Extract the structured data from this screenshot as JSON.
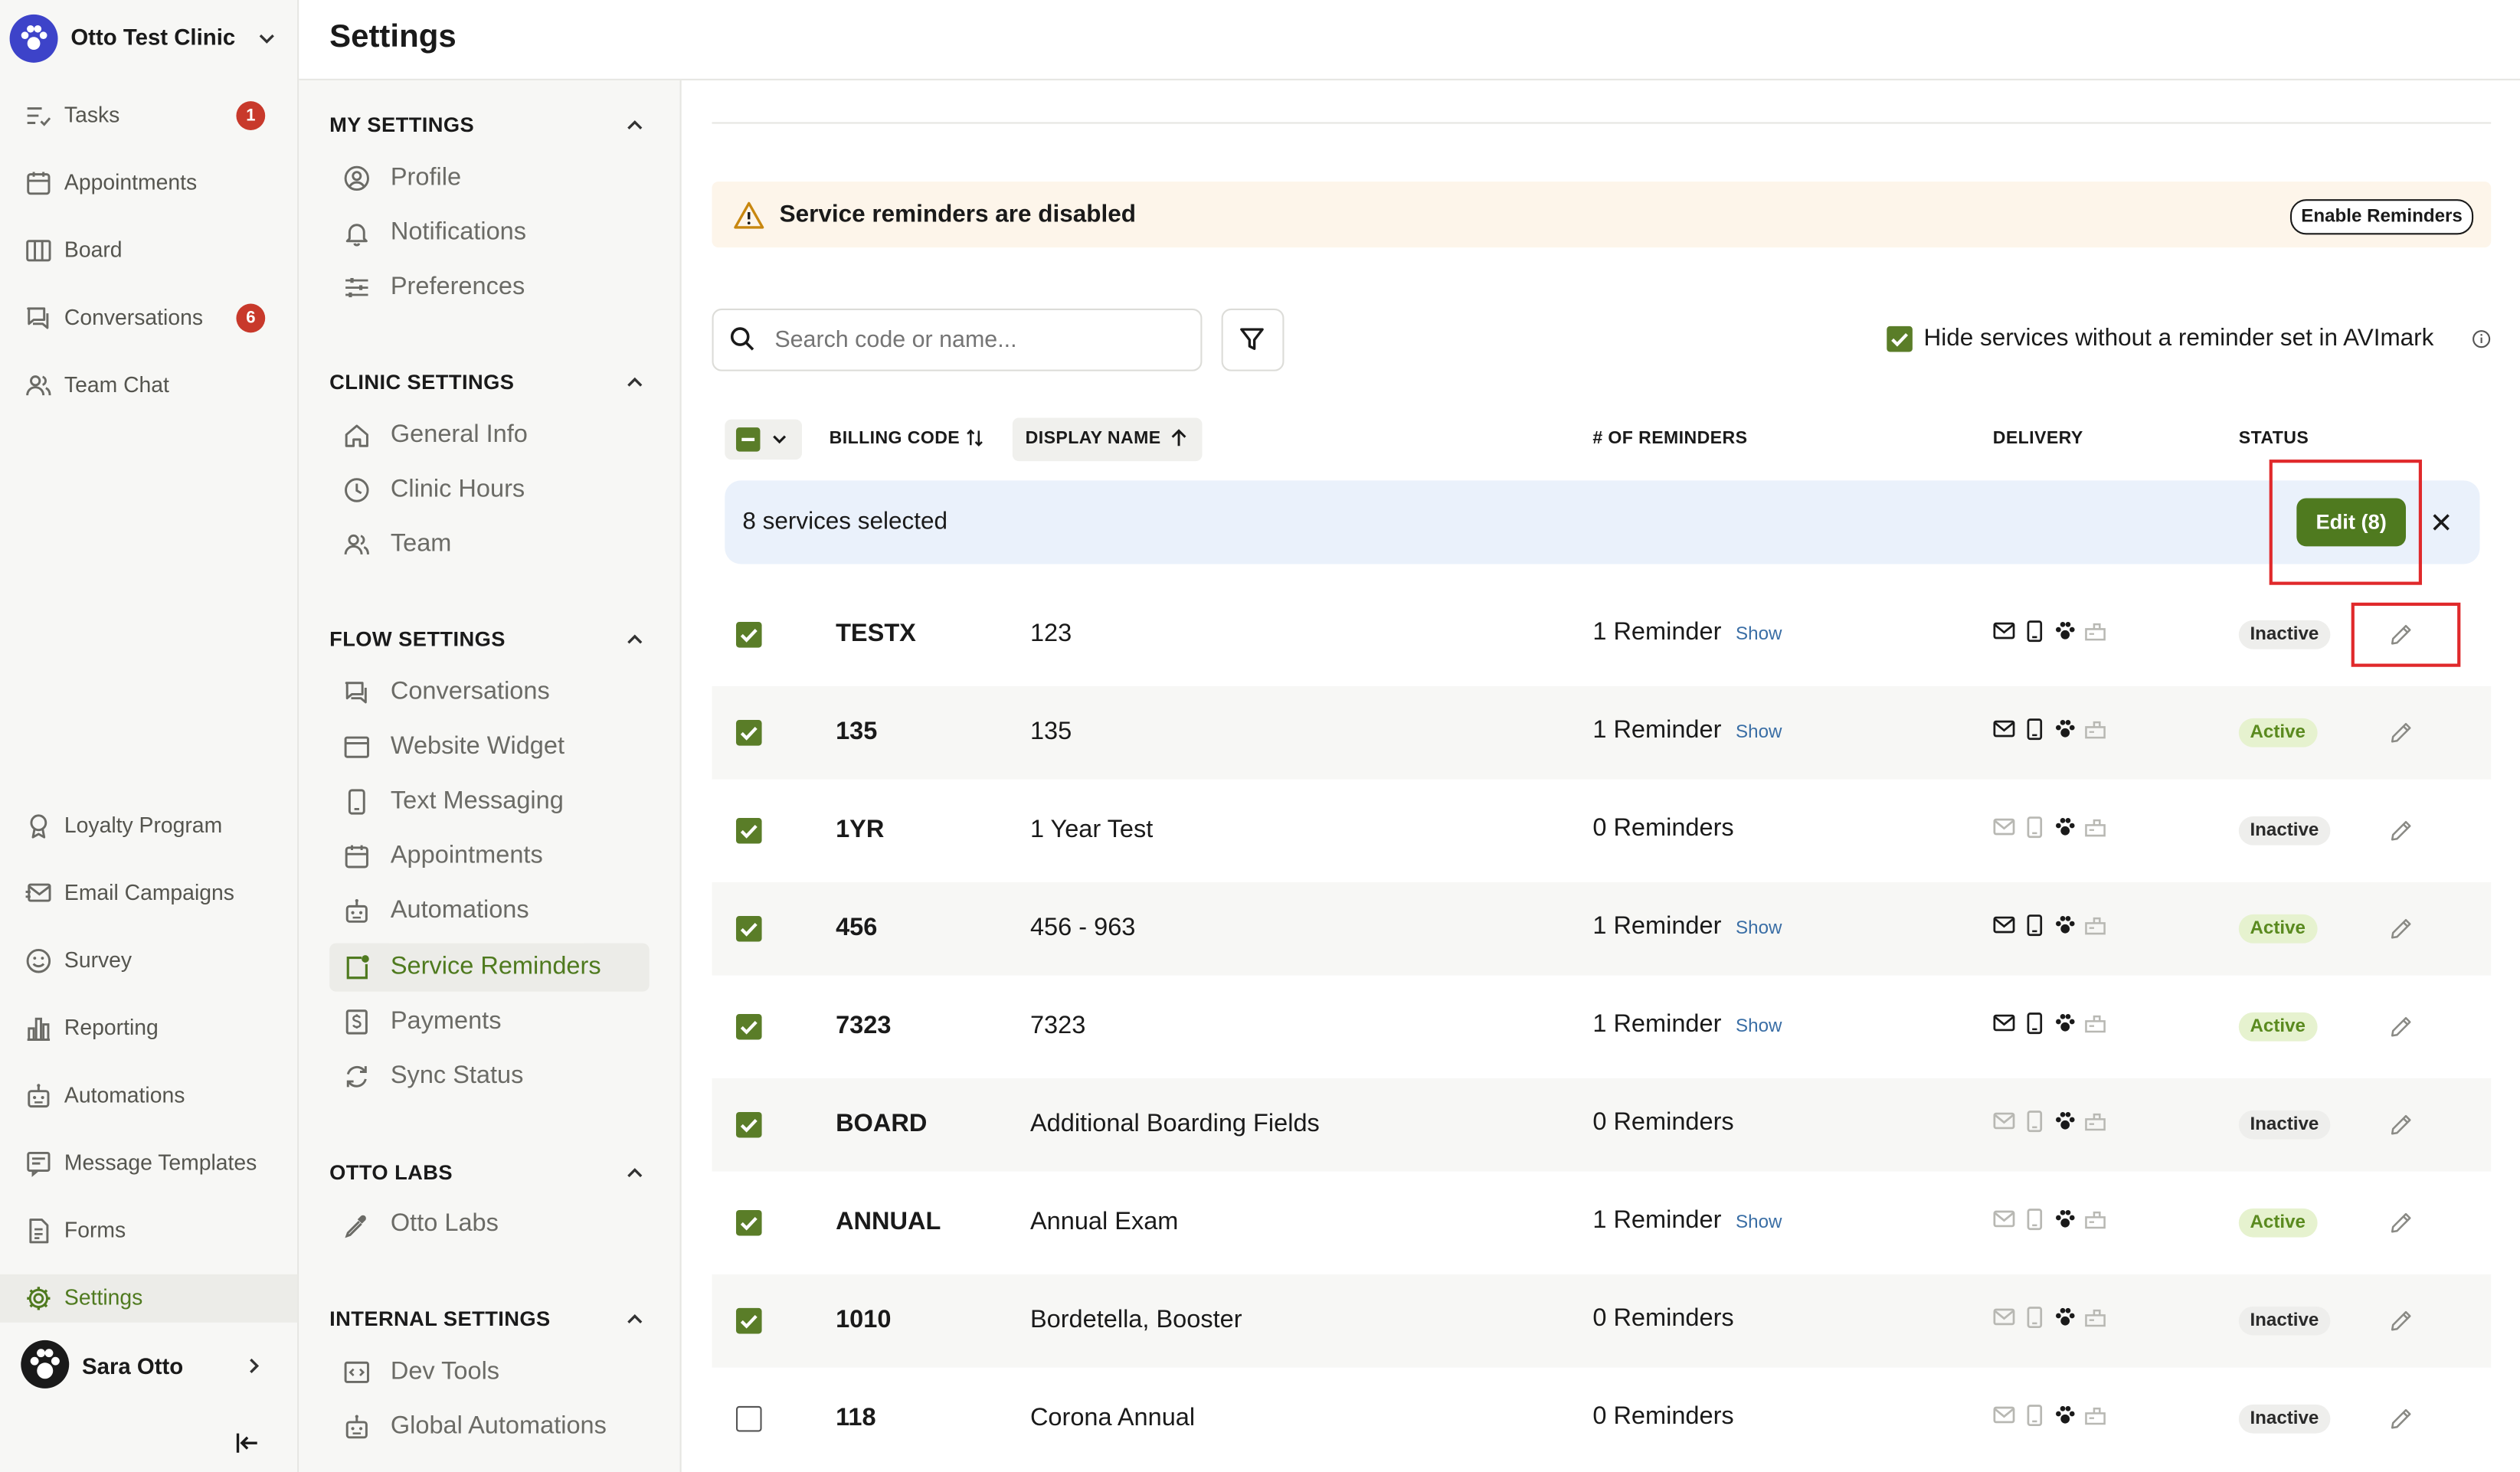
{
  "clinic": {
    "name": "Otto Test Clinic"
  },
  "nav": {
    "top": [
      {
        "label": "Tasks",
        "icon": "tasks-icon",
        "badge": "1"
      },
      {
        "label": "Appointments",
        "icon": "calendar-icon",
        "badge": ""
      },
      {
        "label": "Board",
        "icon": "board-icon",
        "badge": ""
      },
      {
        "label": "Conversations",
        "icon": "chat-bubbles-icon",
        "badge": "6"
      },
      {
        "label": "Team Chat",
        "icon": "team-icon",
        "badge": ""
      }
    ],
    "bottom": [
      {
        "label": "Loyalty Program",
        "icon": "ribbon-icon"
      },
      {
        "label": "Email Campaigns",
        "icon": "email-campaign-icon"
      },
      {
        "label": "Survey",
        "icon": "smiley-icon"
      },
      {
        "label": "Reporting",
        "icon": "bar-chart-icon"
      },
      {
        "label": "Automations",
        "icon": "robot-icon"
      },
      {
        "label": "Message Templates",
        "icon": "message-template-icon"
      },
      {
        "label": "Forms",
        "icon": "document-icon"
      },
      {
        "label": "Settings",
        "icon": "gear-icon",
        "active": true
      }
    ],
    "user": {
      "name": "Sara Otto"
    }
  },
  "page": {
    "title": "Settings"
  },
  "settings_nav": {
    "sections": [
      {
        "title": "MY SETTINGS",
        "items": [
          {
            "label": "Profile",
            "icon": "user-circle-icon"
          },
          {
            "label": "Notifications",
            "icon": "bell-icon"
          },
          {
            "label": "Preferences",
            "icon": "sliders-icon"
          }
        ]
      },
      {
        "title": "CLINIC SETTINGS",
        "items": [
          {
            "label": "General Info",
            "icon": "home-icon"
          },
          {
            "label": "Clinic Hours",
            "icon": "clock-icon"
          },
          {
            "label": "Team",
            "icon": "team-icon"
          }
        ]
      },
      {
        "title": "FLOW SETTINGS",
        "items": [
          {
            "label": "Conversations",
            "icon": "chat-bubbles-icon"
          },
          {
            "label": "Website Widget",
            "icon": "browser-icon"
          },
          {
            "label": "Text Messaging",
            "icon": "phone-icon"
          },
          {
            "label": "Appointments",
            "icon": "calendar-icon"
          },
          {
            "label": "Automations",
            "icon": "robot-icon"
          },
          {
            "label": "Service Reminders",
            "icon": "reminder-icon",
            "active": true
          },
          {
            "label": "Payments",
            "icon": "dollar-icon"
          },
          {
            "label": "Sync Status",
            "icon": "sync-icon"
          }
        ]
      },
      {
        "title": "OTTO LABS",
        "items": [
          {
            "label": "Otto Labs",
            "icon": "pipette-icon"
          }
        ]
      },
      {
        "title": "INTERNAL SETTINGS",
        "items": [
          {
            "label": "Dev Tools",
            "icon": "code-icon"
          },
          {
            "label": "Global Automations",
            "icon": "robot-icon"
          }
        ]
      }
    ]
  },
  "banner": {
    "text": "Service reminders are disabled",
    "button": "Enable Reminders"
  },
  "toolbar": {
    "search_placeholder": "Search code or name...",
    "hide_label": "Hide services without a reminder set in AVImark",
    "hide_checked": true
  },
  "table": {
    "headers": {
      "billing_code": "BILLING CODE",
      "display_name": "DISPLAY NAME",
      "reminders": "# OF REMINDERS",
      "delivery": "DELIVERY",
      "status": "STATUS"
    },
    "selection": {
      "text": "8 services selected",
      "edit_button": "Edit (8)"
    },
    "rows": [
      {
        "checked": true,
        "code": "TESTX",
        "name": "123",
        "reminders": "1 Reminder",
        "show": "Show",
        "delivery_on": true,
        "status": "Inactive"
      },
      {
        "checked": true,
        "code": "135",
        "name": "135",
        "reminders": "1 Reminder",
        "show": "Show",
        "delivery_on": true,
        "status": "Active"
      },
      {
        "checked": true,
        "code": "1YR",
        "name": "1 Year Test",
        "reminders": "0 Reminders",
        "show": "",
        "delivery_on": false,
        "status": "Inactive"
      },
      {
        "checked": true,
        "code": "456",
        "name": "456 - 963",
        "reminders": "1 Reminder",
        "show": "Show",
        "delivery_on": true,
        "status": "Active"
      },
      {
        "checked": true,
        "code": "7323",
        "name": "7323",
        "reminders": "1 Reminder",
        "show": "Show",
        "delivery_on": true,
        "status": "Active"
      },
      {
        "checked": true,
        "code": "BOARD",
        "name": "Additional Boarding Fields",
        "reminders": "0 Reminders",
        "show": "",
        "delivery_on": false,
        "status": "Inactive"
      },
      {
        "checked": true,
        "code": "ANNUAL",
        "name": "Annual Exam",
        "reminders": "1 Reminder",
        "show": "Show",
        "delivery_on": false,
        "status": "Active"
      },
      {
        "checked": true,
        "code": "1010",
        "name": "Bordetella, Booster",
        "reminders": "0 Reminders",
        "show": "",
        "delivery_on": false,
        "status": "Inactive"
      },
      {
        "checked": false,
        "code": "118",
        "name": "Corona Annual",
        "reminders": "0 Reminders",
        "show": "",
        "delivery_on": false,
        "status": "Inactive"
      }
    ]
  },
  "colors": {
    "accent": "#4f7a1f",
    "highlight": "#e0292b",
    "badge": "#c8392b",
    "banner_bg": "#fdf5ea",
    "selection_bg": "#eaf1fb"
  }
}
